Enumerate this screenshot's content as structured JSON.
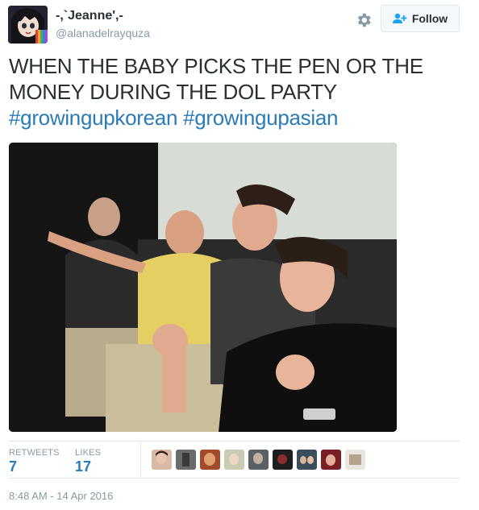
{
  "tweet": {
    "display_name": "-,`Jeanne',-",
    "handle": "@alanadelrayquza",
    "follow_label": "Follow",
    "text_lines": [
      "WHEN THE BABY PICKS THE PEN OR THE",
      "MONEY DURING THE DOL PARTY"
    ],
    "hashtags": [
      "#growingupkorean",
      "#growingupasian"
    ],
    "timestamp": "8:48 AM - 14 Apr 2016"
  },
  "stats": {
    "retweets_label": "RETWEETS",
    "retweets_count": "7",
    "likes_label": "LIKES",
    "likes_count": "17"
  },
  "icons": {
    "settings": "gear-icon",
    "follow": "add-user-icon"
  },
  "colors": {
    "link": "#2b7bb9",
    "text": "#292f33",
    "muted": "#8899a6",
    "border": "#e1e8ed"
  },
  "liker_avatars": [
    "liker-avatar-1",
    "liker-avatar-2",
    "liker-avatar-3",
    "liker-avatar-4",
    "liker-avatar-5",
    "liker-avatar-6",
    "liker-avatar-7",
    "liker-avatar-8",
    "liker-avatar-9"
  ]
}
